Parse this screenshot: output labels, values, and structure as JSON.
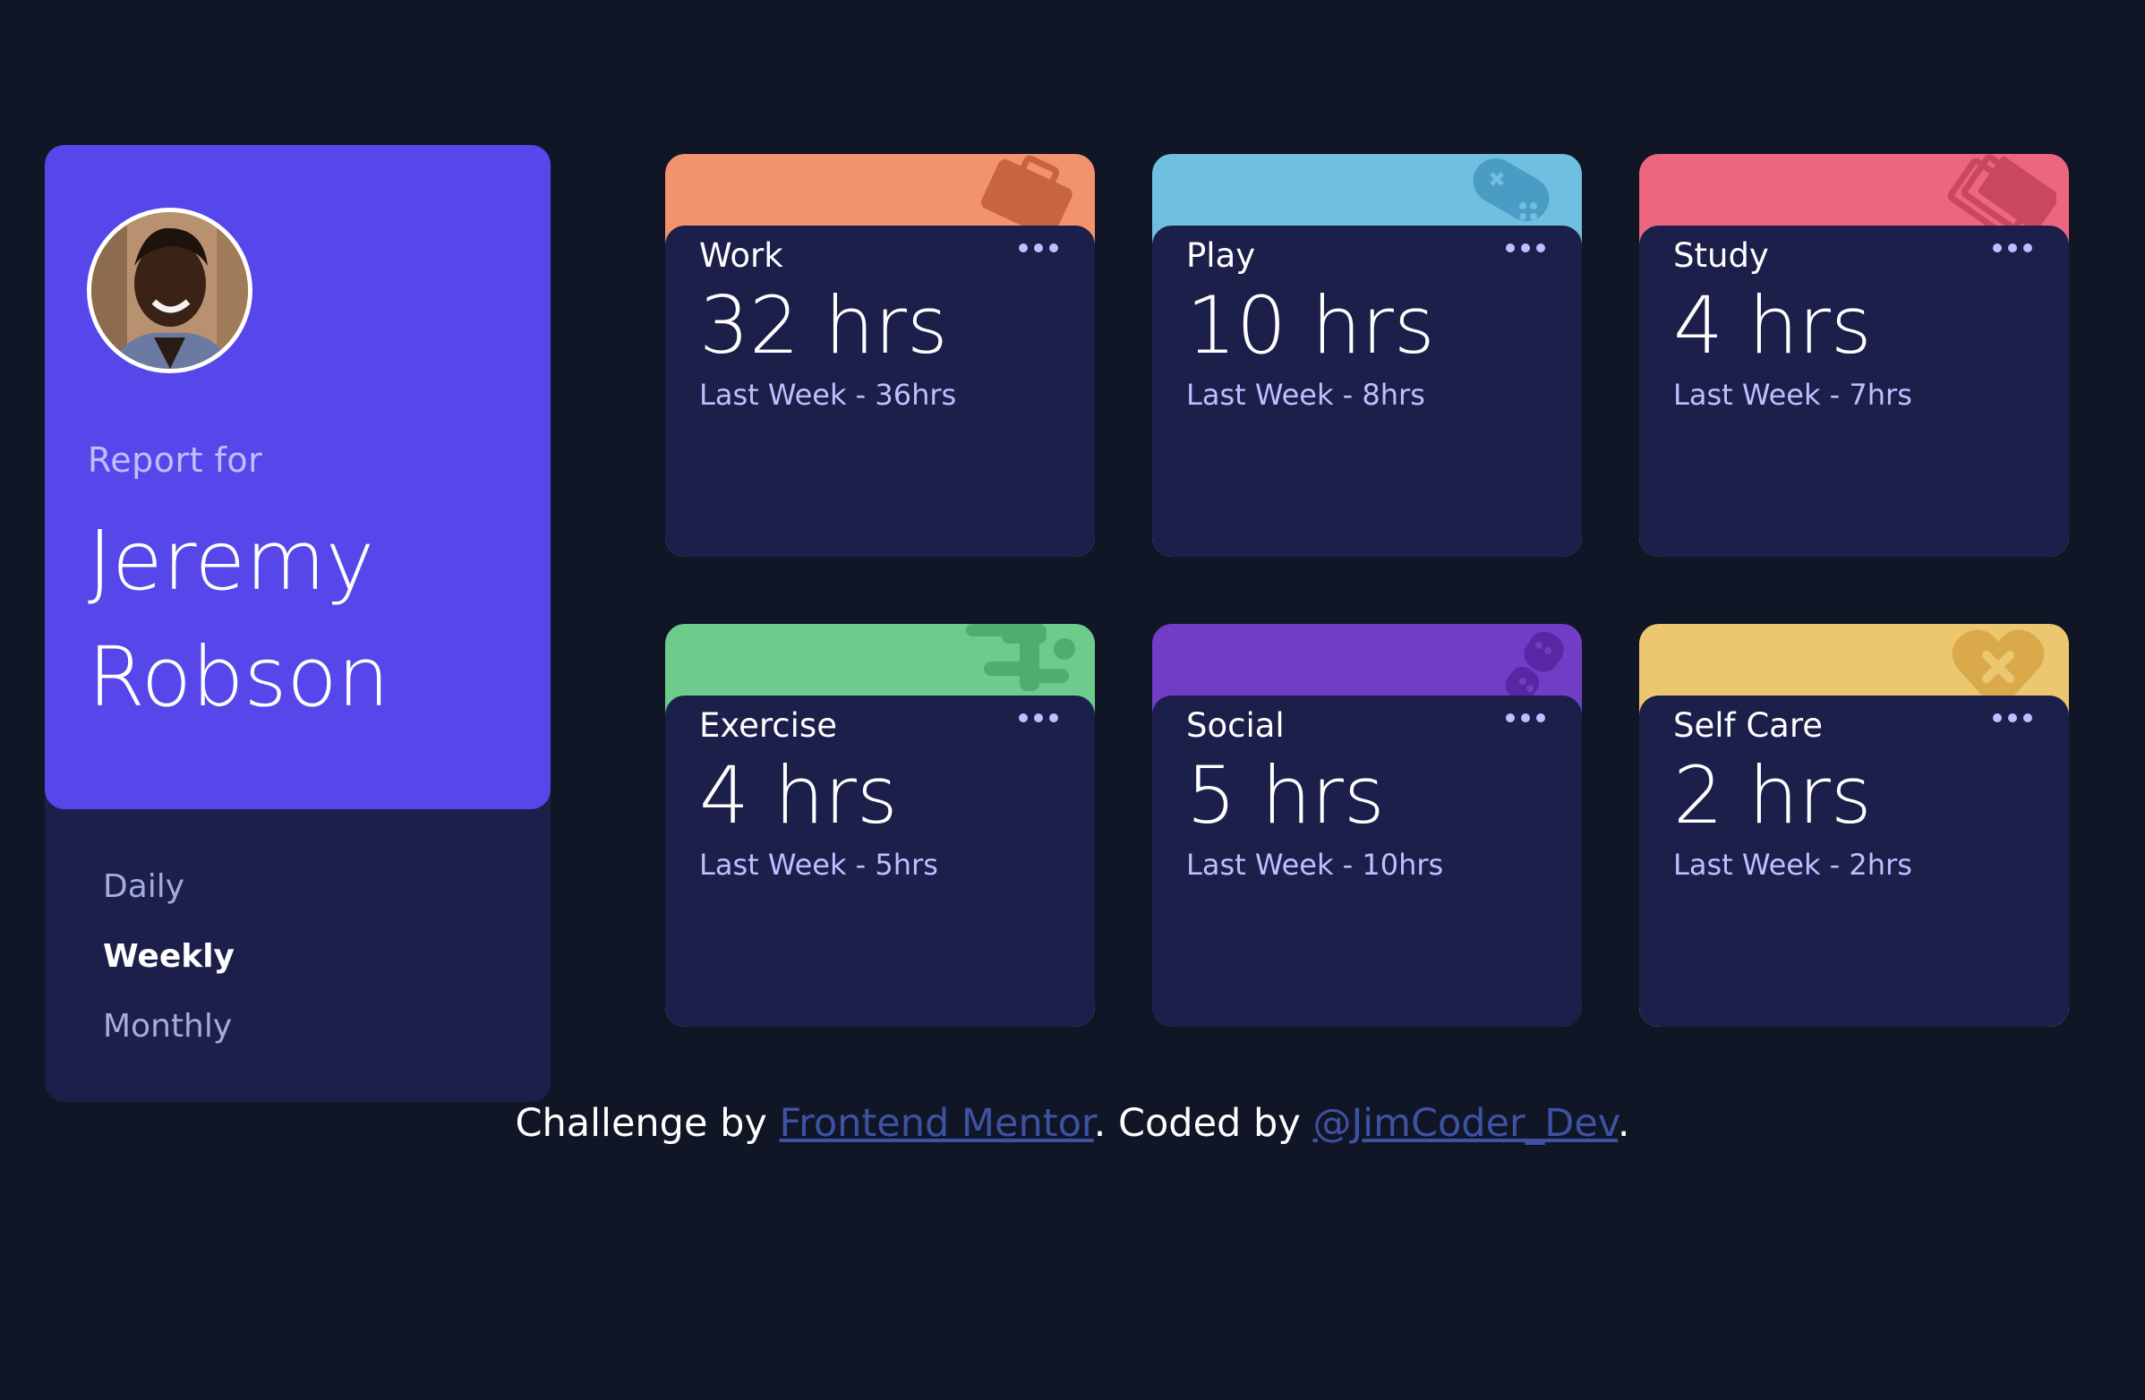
{
  "profile": {
    "report_for": "Report for",
    "first_name": "Jeremy",
    "last_name": "Robson",
    "periods": [
      "Daily",
      "Weekly",
      "Monthly"
    ],
    "active_period": "Weekly"
  },
  "cards": [
    {
      "title": "Work",
      "current": "32 hrs",
      "previous": "Last Week - 36hrs",
      "color": "#f1936b",
      "icon": "briefcase-icon"
    },
    {
      "title": "Play",
      "current": "10 hrs",
      "previous": "Last Week - 8hrs",
      "color": "#6fbfe0",
      "icon": "gamepad-icon"
    },
    {
      "title": "Study",
      "current": "4 hrs",
      "previous": "Last Week - 7hrs",
      "color": "#ec6680",
      "icon": "books-icon"
    },
    {
      "title": "Exercise",
      "current": "4 hrs",
      "previous": "Last Week - 5hrs",
      "color": "#6dcc8b",
      "icon": "running-icon"
    },
    {
      "title": "Social",
      "current": "5 hrs",
      "previous": "Last Week - 10hrs",
      "color": "#713cc6",
      "icon": "social-icon"
    },
    {
      "title": "Self Care",
      "current": "2 hrs",
      "previous": "Last Week - 2hrs",
      "color": "#ebc86f",
      "icon": "heart-icon"
    }
  ],
  "footer": {
    "prefix": "Challenge by ",
    "link1": "Frontend Mentor",
    "middle": ". Coded by ",
    "link2": "@JimCoder_Dev",
    "suffix": "."
  }
}
